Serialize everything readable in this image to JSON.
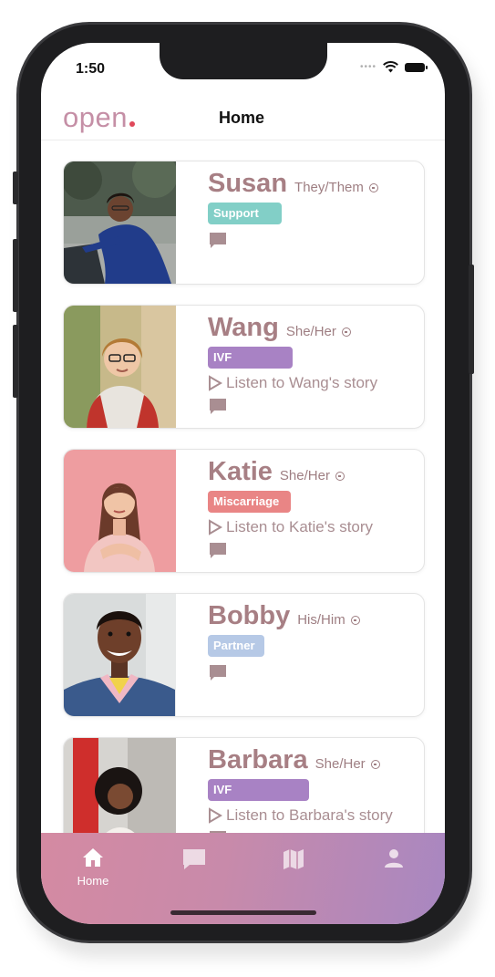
{
  "status": {
    "time": "1:50"
  },
  "header": {
    "logo": "open",
    "title": "Home"
  },
  "colors": {
    "name": "#a77f84",
    "tag_support": "#82cfc7",
    "tag_ivf": "#a882c4",
    "tag_miscarriage": "#e98585",
    "tag_partner": "#b6c9e6",
    "tabbar_start": "#d48aa2",
    "tabbar_end": "#a887c1"
  },
  "profiles": [
    {
      "name": "Susan",
      "pronouns": "They/Them",
      "tag": "Support",
      "listen": ""
    },
    {
      "name": "Wang",
      "pronouns": "She/Her",
      "tag": "IVF",
      "listen": "Listen to Wang's story"
    },
    {
      "name": "Katie",
      "pronouns": "She/Her",
      "tag": "Miscarriage",
      "listen": "Listen to Katie's story"
    },
    {
      "name": "Bobby",
      "pronouns": "His/Him",
      "tag": "Partner",
      "listen": ""
    },
    {
      "name": "Barbara",
      "pronouns": "She/Her",
      "tag": "IVF",
      "listen": "Listen to Barbara's story"
    }
  ],
  "tabs": [
    {
      "label": "Home",
      "icon": "home-icon",
      "active": true
    },
    {
      "label": "",
      "icon": "chat-icon",
      "active": false
    },
    {
      "label": "",
      "icon": "map-icon",
      "active": false
    },
    {
      "label": "",
      "icon": "profile-icon",
      "active": false
    }
  ]
}
